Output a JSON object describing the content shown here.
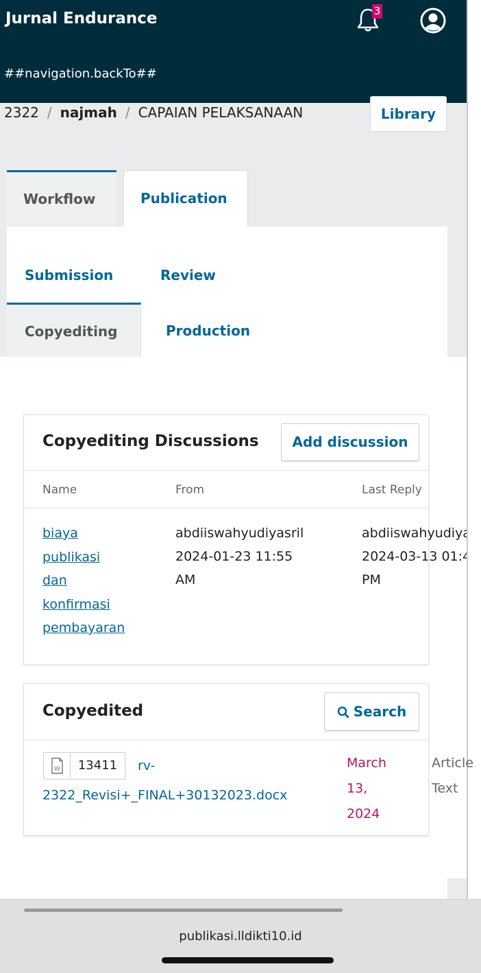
{
  "header": {
    "title": "Jurnal Endurance",
    "back_link": "##navigation.backTo##",
    "notification_count": "3"
  },
  "breadcrumb": {
    "id": "2322",
    "author": "najmah",
    "title": "CAPAIAN PELAKSANAAN"
  },
  "library_button": "Library",
  "tabs": {
    "workflow": "Workflow",
    "publication": "Publication"
  },
  "stages": {
    "submission": "Submission",
    "review": "Review",
    "copyediting": "Copyediting",
    "production": "Production"
  },
  "discussions": {
    "title": "Copyediting Discussions",
    "add_button": "Add discussion",
    "columns": {
      "name": "Name",
      "from": "From",
      "last_reply": "Last Reply"
    },
    "row": {
      "name_lines": [
        "biaya",
        "publikasi",
        "dan",
        "konfirmasi",
        "pembayaran"
      ],
      "from_user": "abdiiswahyudiyasril",
      "from_date": "2024-01-23 11:55",
      "from_ampm": "AM",
      "reply_user": "abdiiswahyudiyasril",
      "reply_date": "2024-03-13 01:4",
      "reply_ampm": "PM"
    }
  },
  "copyedited": {
    "title": "Copyedited",
    "search_button": "Search",
    "file": {
      "id": "13411",
      "name_line1": "rv-",
      "name_line2": "2322_Revisi+_FINAL+30132023.docx",
      "date_lines": [
        "March",
        "13,",
        "2024"
      ],
      "type_lines": [
        "Article",
        "Text"
      ]
    }
  },
  "browser": {
    "url": "publikasi.lldikti10.id"
  },
  "colors": {
    "header_bg": "#002c3c",
    "link": "#006798",
    "badge": "#d00a6c",
    "date": "#b3165f"
  }
}
